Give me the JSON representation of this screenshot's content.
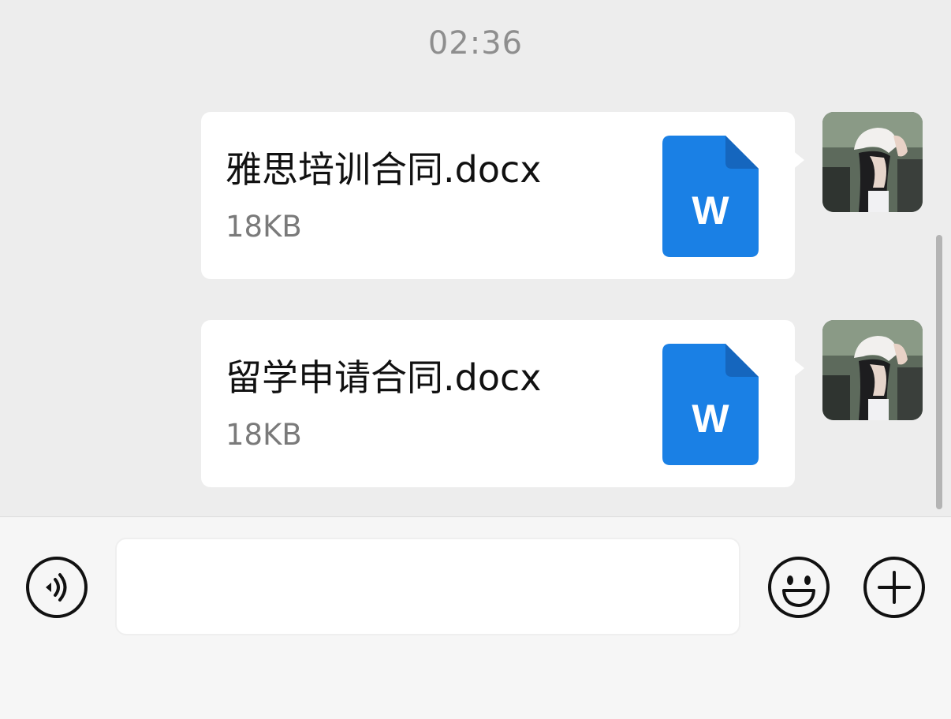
{
  "chat": {
    "timestamp": "02:36",
    "messages": [
      {
        "file_name": "雅思培训合同.docx",
        "file_size": "18KB",
        "file_type_letter": "W"
      },
      {
        "file_name": "留学申请合同.docx",
        "file_size": "18KB",
        "file_type_letter": "W"
      }
    ]
  },
  "input_bar": {
    "text_value": "",
    "icons": {
      "voice": "voice-icon",
      "emoji": "emoji-icon",
      "more": "plus-icon"
    }
  },
  "colors": {
    "background": "#ededed",
    "bubble": "#ffffff",
    "word_icon": "#1a80e5",
    "word_icon_fold": "#1566be",
    "timestamp": "#8e8e8e"
  }
}
